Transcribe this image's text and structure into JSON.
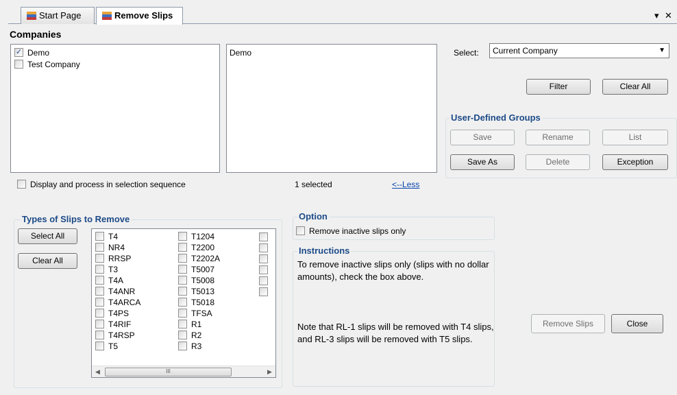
{
  "tabs": [
    {
      "label": "Start Page",
      "active": false
    },
    {
      "label": "Remove Slips",
      "active": true
    }
  ],
  "window_controls": {
    "dropdown_glyph": "▾",
    "close_glyph": "✕"
  },
  "companies": {
    "heading": "Companies",
    "items": [
      {
        "label": "Demo",
        "checked": true
      },
      {
        "label": "Test Company",
        "checked": false
      }
    ],
    "selected_list": [
      "Demo"
    ],
    "sequence_label": "Display and process in selection sequence",
    "selected_count": "1 selected",
    "less_link": "<--Less"
  },
  "select_control": {
    "label": "Select:",
    "value": "Current Company"
  },
  "filter_button": "Filter",
  "clear_all_top_button": "Clear All",
  "user_groups": {
    "title": "User-Defined Groups",
    "buttons": {
      "save": "Save",
      "rename": "Rename",
      "list": "List",
      "save_as": "Save As",
      "delete": "Delete",
      "exception": "Exception"
    }
  },
  "slip_types": {
    "title": "Types of Slips to Remove",
    "select_all": "Select All",
    "clear_all": "Clear All",
    "col1": [
      "T4",
      "NR4",
      "RRSP",
      "T3",
      "T4A",
      "T4ANR",
      "T4ARCA",
      "T4PS",
      "T4RIF",
      "T4RSP",
      "T5"
    ],
    "col2": [
      "T1204",
      "T2200",
      "T2202A",
      "T5007",
      "T5008",
      "T5013",
      "T5018",
      "TFSA",
      "R1",
      "R2",
      "R3"
    ],
    "scroll_thumb_glyph": "III"
  },
  "option": {
    "title": "Option",
    "inactive_label": "Remove inactive slips only"
  },
  "instructions": {
    "title": "Instructions",
    "text1": "To remove inactive slips only (slips with no dollar amounts), check the box above.",
    "text2": "Note that RL-1 slips will be removed with T4 slips, and RL-3 slips will be removed with T5 slips."
  },
  "actions": {
    "remove_slips": "Remove Slips",
    "close": "Close"
  },
  "colors": {
    "group_title": "#1c4a87",
    "link": "#0645ad",
    "panel_bg": "#f0f0f0"
  }
}
